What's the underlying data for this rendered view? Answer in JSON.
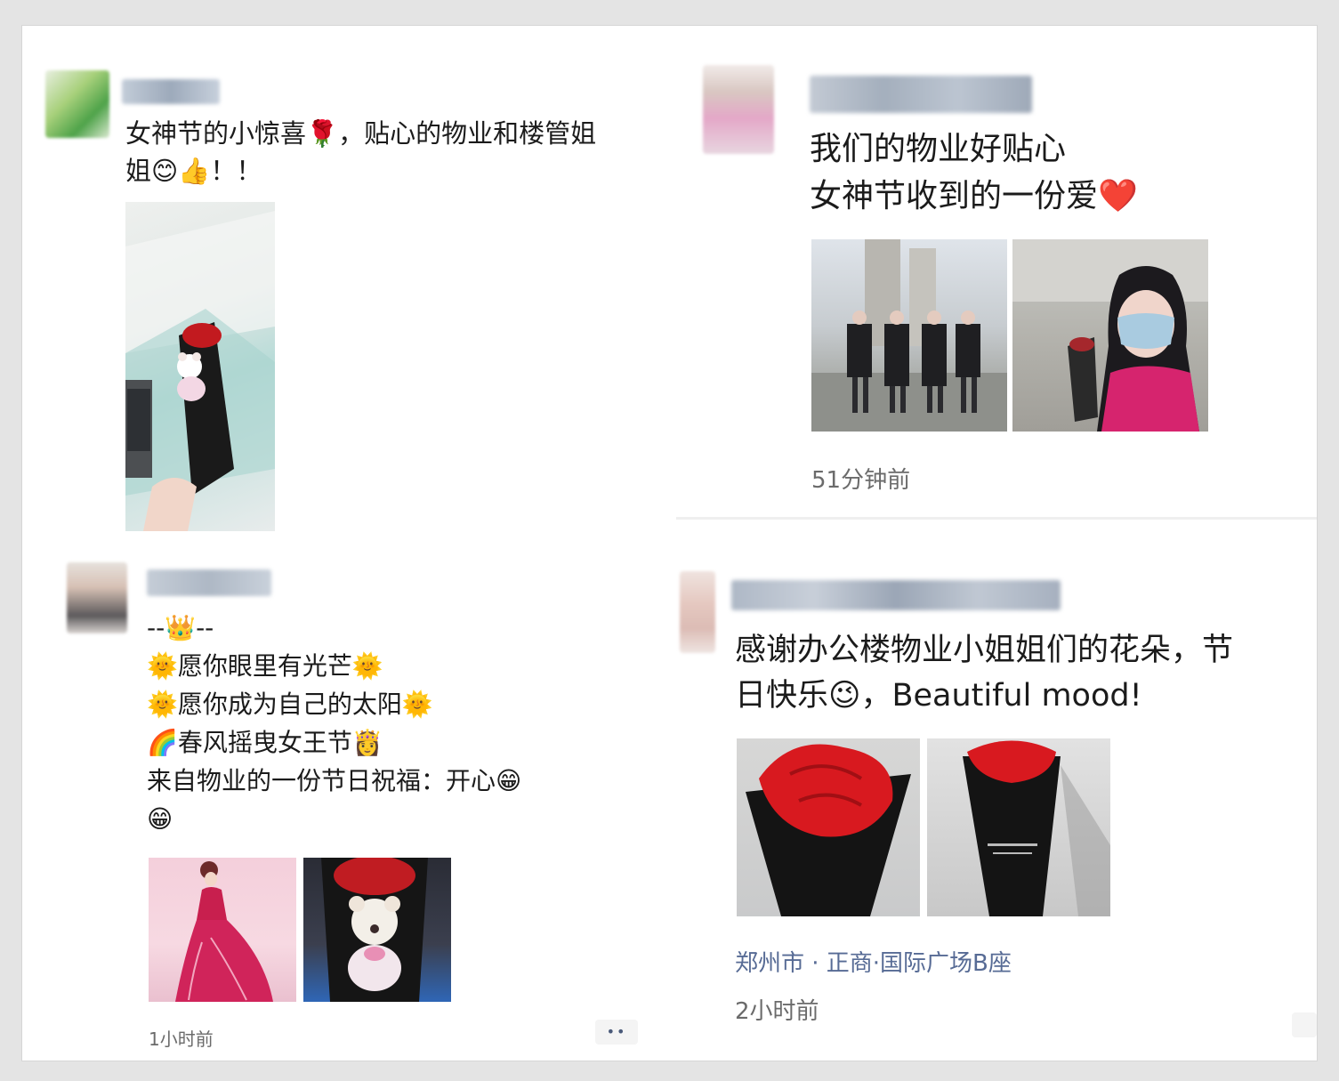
{
  "posts": [
    {
      "text": "女神节的小惊喜🌹，贴心的物业和楼管姐\n姐😊👍！！",
      "images": [
        "bouquet-bear-photo"
      ]
    },
    {
      "text": "我们的物业好贴心\n女神节收到的一份爱❤️",
      "time": "51分钟前",
      "images": [
        "staff-group-photo",
        "woman-with-rose-photo"
      ]
    },
    {
      "text": "--👑--\n🌞愿你眼里有光芒🌞\n🌞愿你成为自己的太阳🌞\n🌈春风摇曳女王节👸\n来自物业的一份节日祝福：开心😁\n😁",
      "time": "1小时前",
      "more": "••",
      "images": [
        "goddess-illustration",
        "bear-bouquet-photo"
      ]
    },
    {
      "text": "感谢办公楼物业小姐姐们的花朵，节\n日快乐😉，Beautiful mood!",
      "location": "郑州市 · 正商·国际广场B座",
      "time": "2小时前",
      "images": [
        "red-rose-photo-1",
        "red-rose-photo-2"
      ]
    }
  ],
  "colors": {
    "rose": "#d8191f",
    "wrap": "#141414",
    "link": "#576b95"
  }
}
